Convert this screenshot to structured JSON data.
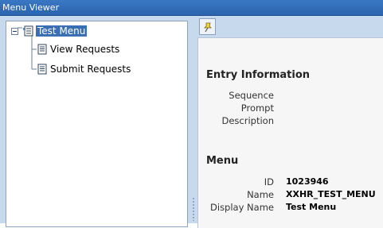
{
  "window": {
    "title": "Menu Viewer"
  },
  "tree": {
    "root": {
      "label": "Test Menu",
      "icon": "menu-folder-icon",
      "expanded": true,
      "selected": true
    },
    "children": [
      {
        "label": "View Requests",
        "icon": "function-document-icon"
      },
      {
        "label": "Submit Requests",
        "icon": "function-document-icon"
      }
    ]
  },
  "toolbar": {
    "pin_icon": "pushpin-icon"
  },
  "entry_information": {
    "heading": "Entry Information",
    "fields": [
      {
        "label": "Sequence",
        "value": ""
      },
      {
        "label": "Prompt",
        "value": ""
      },
      {
        "label": "Description",
        "value": ""
      }
    ]
  },
  "menu": {
    "heading": "Menu",
    "fields": [
      {
        "label": "ID",
        "value": "1023946"
      },
      {
        "label": "Name",
        "value": "XXHR_TEST_MENU"
      },
      {
        "label": "Display Name",
        "value": "Test Menu"
      }
    ]
  },
  "colors": {
    "titlebar": "#2b63ad",
    "background": "#c7d9ec",
    "selection": "#3b6fb3"
  }
}
